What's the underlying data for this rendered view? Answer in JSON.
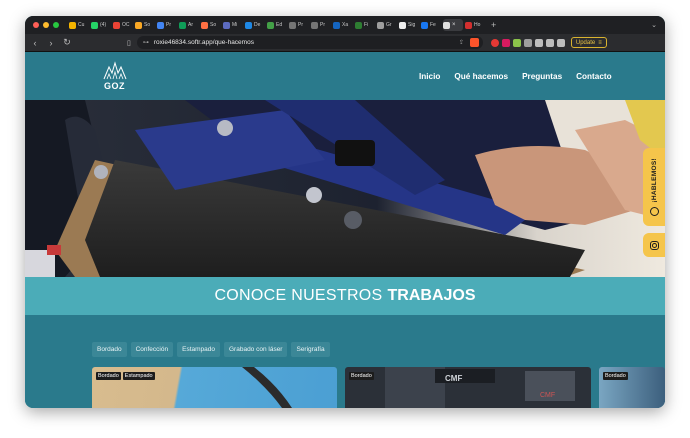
{
  "browser": {
    "tabs": [
      {
        "label": "Cu",
        "color": "#f4b400"
      },
      {
        "label": "(4)",
        "color": "#25d366"
      },
      {
        "label": "OC",
        "color": "#ea4335"
      },
      {
        "label": "So",
        "color": "#f9a825"
      },
      {
        "label": "Pr",
        "color": "#4285f4"
      },
      {
        "label": "Ar",
        "color": "#0f9d58"
      },
      {
        "label": "So",
        "color": "#ff7043"
      },
      {
        "label": "Mi",
        "color": "#5c6bc0"
      },
      {
        "label": "De",
        "color": "#1e88e5"
      },
      {
        "label": "Ed",
        "color": "#43a047"
      },
      {
        "label": "Pr",
        "color": "#757575"
      },
      {
        "label": "Pr",
        "color": "#757575"
      },
      {
        "label": "Xa",
        "color": "#1565c0"
      },
      {
        "label": "Fi",
        "color": "#2e7d32"
      },
      {
        "label": "Gr",
        "color": "#9e9e9e"
      },
      {
        "label": "Sig",
        "color": "#eeeeee"
      },
      {
        "label": "Fe",
        "color": "#1877f2"
      },
      {
        "label": "",
        "color": "#e0e0e0"
      },
      {
        "label": "Ho",
        "color": "#d32f2f"
      }
    ],
    "active_tab_close": "×",
    "new_tab": "+",
    "tab_menu": "⌄",
    "url": "roxie46834.softr.app/que-hacemos",
    "update_label": "Update"
  },
  "site": {
    "logo_text": "GOZ",
    "nav": [
      "Inicio",
      "Qué hacemos",
      "Preguntas",
      "Contacto"
    ],
    "banner_thin": "CONOCE NUESTROS",
    "banner_bold": "TRABAJOS",
    "filters": [
      "Bordado",
      "Confección",
      "Estampado",
      "Grabado con láser",
      "Serigrafía"
    ],
    "cards": [
      {
        "tags": [
          "Bordado",
          "Estampado"
        ]
      },
      {
        "tags": [
          "Bordado"
        ]
      },
      {
        "tags": [
          "Bordado"
        ]
      }
    ],
    "whatsapp_label": "¡HABLEMOS!"
  }
}
